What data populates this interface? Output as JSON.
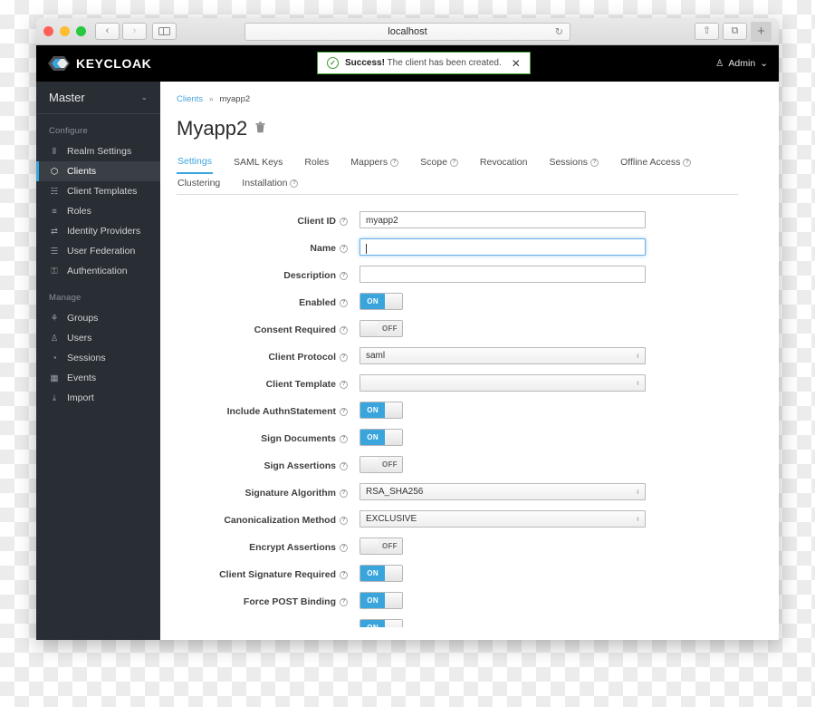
{
  "browser": {
    "url": "localhost",
    "back_icon": "‹",
    "forward_icon": "›",
    "reload_icon": "↻",
    "share_icon": "⇧",
    "tabs_icon": "⧉",
    "newtab_icon": "+"
  },
  "topbar": {
    "logo_text": "KEYCLOAK",
    "alert": {
      "check_icon": "✓",
      "strong": "Success!",
      "message": "The client has been created.",
      "close_icon": "✕"
    },
    "admin": {
      "user_icon": "♙",
      "label": "Admin",
      "chevron": "⌄"
    }
  },
  "sidebar": {
    "realm": {
      "label": "Master",
      "chevron": "⌄"
    },
    "groups": [
      {
        "title": "Configure",
        "items": [
          {
            "label": "Realm Settings",
            "icon": "⦀",
            "active": false
          },
          {
            "label": "Clients",
            "icon": "⬡",
            "active": true
          },
          {
            "label": "Client Templates",
            "icon": "☵",
            "active": false
          },
          {
            "label": "Roles",
            "icon": "≡",
            "active": false
          },
          {
            "label": "Identity Providers",
            "icon": "⇄",
            "active": false
          },
          {
            "label": "User Federation",
            "icon": "☰",
            "active": false
          },
          {
            "label": "Authentication",
            "icon": "⚿",
            "active": false
          }
        ]
      },
      {
        "title": "Manage",
        "items": [
          {
            "label": "Groups",
            "icon": "⚘",
            "active": false
          },
          {
            "label": "Users",
            "icon": "♙",
            "active": false
          },
          {
            "label": "Sessions",
            "icon": "◔",
            "active": false
          },
          {
            "label": "Events",
            "icon": "▦",
            "active": false
          },
          {
            "label": "Import",
            "icon": "⤓",
            "active": false
          }
        ]
      }
    ]
  },
  "main": {
    "breadcrumb": {
      "root": "Clients",
      "separator": "»",
      "current": "myapp2"
    },
    "page_title": "Myapp2",
    "delete_icon": "Ὕ1",
    "tabs": [
      {
        "label": "Settings",
        "help": false,
        "active": true
      },
      {
        "label": "SAML Keys",
        "help": false,
        "active": false
      },
      {
        "label": "Roles",
        "help": false,
        "active": false
      },
      {
        "label": "Mappers",
        "help": true,
        "active": false
      },
      {
        "label": "Scope",
        "help": true,
        "active": false
      },
      {
        "label": "Revocation",
        "help": false,
        "active": false
      },
      {
        "label": "Sessions",
        "help": true,
        "active": false
      },
      {
        "label": "Offline Access",
        "help": true,
        "active": false
      },
      {
        "label": "Clustering",
        "help": false,
        "active": false
      },
      {
        "label": "Installation",
        "help": true,
        "active": false
      }
    ],
    "help_icon": "?",
    "toggle_on_label": "ON",
    "toggle_off_label": "OFF",
    "select_arrows": "↕",
    "fields": [
      {
        "label": "Client ID",
        "help": true,
        "type": "text",
        "value": "myapp2",
        "focused": false
      },
      {
        "label": "Name",
        "help": true,
        "type": "text",
        "value": "",
        "focused": true
      },
      {
        "label": "Description",
        "help": true,
        "type": "text",
        "value": "",
        "focused": false
      },
      {
        "label": "Enabled",
        "help": true,
        "type": "toggle",
        "value": "ON"
      },
      {
        "label": "Consent Required",
        "help": true,
        "type": "toggle",
        "value": "OFF"
      },
      {
        "label": "Client Protocol",
        "help": true,
        "type": "select",
        "value": "saml"
      },
      {
        "label": "Client Template",
        "help": true,
        "type": "select",
        "value": ""
      },
      {
        "label": "Include AuthnStatement",
        "help": true,
        "type": "toggle",
        "value": "ON"
      },
      {
        "label": "Sign Documents",
        "help": true,
        "type": "toggle",
        "value": "ON"
      },
      {
        "label": "Sign Assertions",
        "help": true,
        "type": "toggle",
        "value": "OFF"
      },
      {
        "label": "Signature Algorithm",
        "help": true,
        "type": "select",
        "value": "RSA_SHA256"
      },
      {
        "label": "Canonicalization Method",
        "help": true,
        "type": "select",
        "value": "EXCLUSIVE"
      },
      {
        "label": "Encrypt Assertions",
        "help": true,
        "type": "toggle",
        "value": "OFF"
      },
      {
        "label": "Client Signature Required",
        "help": true,
        "type": "toggle",
        "value": "ON"
      },
      {
        "label": "Force POST Binding",
        "help": true,
        "type": "toggle",
        "value": "ON"
      },
      {
        "label": "",
        "help": false,
        "type": "toggle",
        "value": "ON"
      }
    ]
  },
  "colors": {
    "accent": "#39a5dc",
    "sidebar_bg": "#292e34",
    "topbar_bg": "#000000",
    "success": "#3f9c35",
    "link": "#4aa3df"
  }
}
